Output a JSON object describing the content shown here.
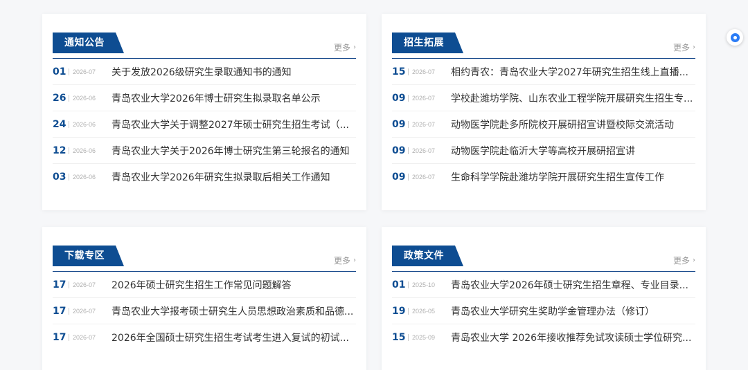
{
  "more_label": "更多",
  "panels": [
    {
      "title": "通知公告",
      "items": [
        {
          "day": "01",
          "ym": "2026-07",
          "title": "关于发放2026级研究生录取通知书的通知"
        },
        {
          "day": "26",
          "ym": "2026-06",
          "title": "青岛农业大学2026年博士研究生拟录取名单公示"
        },
        {
          "day": "24",
          "ym": "2026-06",
          "title": "青岛农业大学关于调整2027年硕士研究生招生考试（..."
        },
        {
          "day": "12",
          "ym": "2026-06",
          "title": "青岛农业大学关于2026年博士研究生第三轮报名的通知"
        },
        {
          "day": "03",
          "ym": "2026-06",
          "title": "青岛农业大学2026年研究生拟录取后相关工作通知"
        }
      ]
    },
    {
      "title": "招生拓展",
      "items": [
        {
          "day": "15",
          "ym": "2026-07",
          "title": "相约青农：青岛农业大学2027年研究生招生线上直播..."
        },
        {
          "day": "09",
          "ym": "2026-07",
          "title": "学校赴潍坊学院、山东农业工程学院开展研究生招生专..."
        },
        {
          "day": "09",
          "ym": "2026-07",
          "title": "动物医学院赴多所院校开展研招宣讲暨校际交流活动"
        },
        {
          "day": "09",
          "ym": "2026-07",
          "title": "动物医学院赴临沂大学等高校开展研招宣讲"
        },
        {
          "day": "09",
          "ym": "2026-07",
          "title": "生命科学学院赴潍坊学院开展研究生招生宣传工作"
        }
      ]
    },
    {
      "title": "下载专区",
      "items": [
        {
          "day": "17",
          "ym": "2026-07",
          "title": "2026年硕士研究生招生工作常见问题解答"
        },
        {
          "day": "17",
          "ym": "2026-07",
          "title": "青岛农业大学报考硕士研究生人员思想政治素质和品德..."
        },
        {
          "day": "17",
          "ym": "2026-07",
          "title": "2026年全国硕士研究生招生考试考生进入复试的初试..."
        }
      ]
    },
    {
      "title": "政策文件",
      "items": [
        {
          "day": "01",
          "ym": "2025-10",
          "title": "青岛农业大学2026年硕士研究生招生章程、专业目录..."
        },
        {
          "day": "19",
          "ym": "2026-05",
          "title": "青岛农业大学研究生奖助学金管理办法（修订）"
        },
        {
          "day": "15",
          "ym": "2025-09",
          "title": "青岛农业大学 2026年接收推荐免试攻读硕士学位研究..."
        }
      ]
    }
  ],
  "colors": {
    "accent": "#0e4d92",
    "float_button": "#2b7cf6"
  }
}
